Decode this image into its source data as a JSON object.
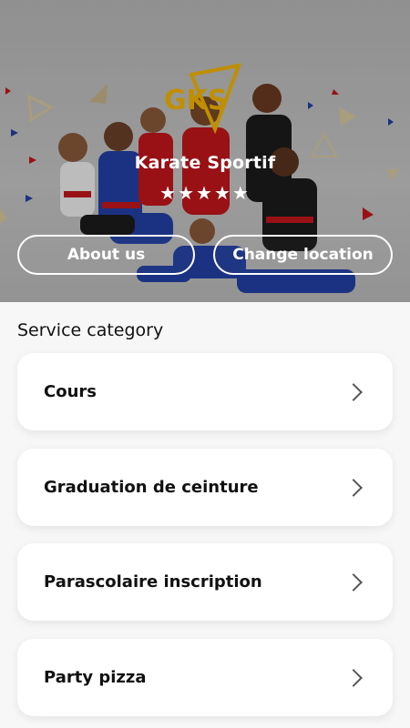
{
  "hero": {
    "brand_title": "Karate Sportif",
    "rating_stars": "★★★★★",
    "about_label": "About us",
    "change_location_label": "Change location",
    "logo_text": "GKS",
    "colors": {
      "logo": "#f5b800",
      "accent_red": "#c4161c",
      "gi_blue": "#2340a8"
    }
  },
  "services": {
    "title": "Service category",
    "items": [
      {
        "label": "Cours"
      },
      {
        "label": "Graduation de ceinture"
      },
      {
        "label": "Parascolaire inscription"
      },
      {
        "label": "Party pizza"
      }
    ]
  }
}
